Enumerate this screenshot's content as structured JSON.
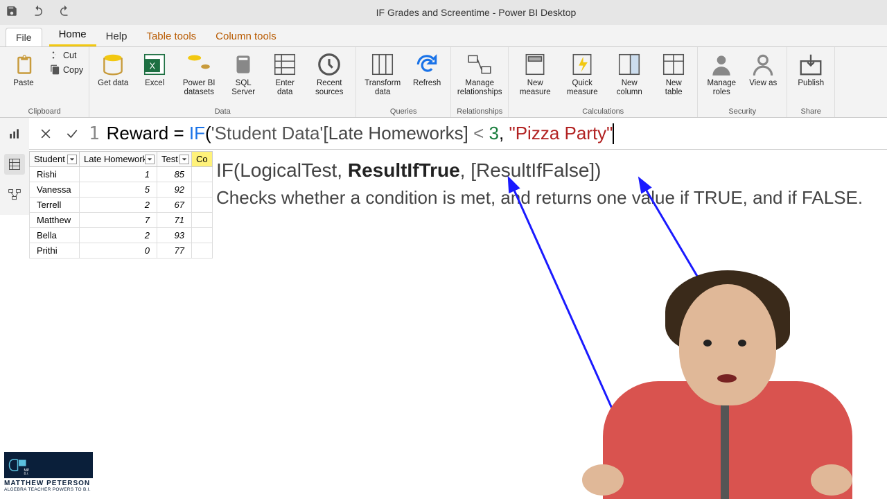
{
  "title": "IF Grades and Screentime - Power BI Desktop",
  "menu": {
    "file": "File",
    "tabs": [
      "Home",
      "Help",
      "Table tools",
      "Column tools"
    ],
    "active_index": 0
  },
  "ribbon": {
    "clipboard": {
      "label": "Clipboard",
      "paste": "Paste",
      "cut": "Cut",
      "copy": "Copy"
    },
    "data": {
      "label": "Data",
      "get_data": "Get data",
      "excel": "Excel",
      "pbi_ds": "Power BI datasets",
      "sql": "SQL Server",
      "enter": "Enter data",
      "recent": "Recent sources"
    },
    "queries": {
      "label": "Queries",
      "transform": "Transform data",
      "refresh": "Refresh"
    },
    "relationships": {
      "label": "Relationships",
      "manage": "Manage relationships"
    },
    "calculations": {
      "label": "Calculations",
      "new_measure": "New measure",
      "quick_measure": "Quick measure",
      "new_column": "New column",
      "new_table": "New table"
    },
    "security": {
      "label": "Security",
      "manage_roles": "Manage roles",
      "view_as": "View as"
    },
    "share": {
      "label": "Share",
      "publish": "Publish"
    }
  },
  "formula": {
    "line": "1",
    "name": "Reward",
    "eq": " = ",
    "fn": "IF",
    "open": "(",
    "table": "'Student Data'",
    "col": "[Late Homeworks]",
    "op": " < ",
    "num": "3",
    "comma": ", ",
    "str": "\"Pizza Party\""
  },
  "table": {
    "headers": [
      "Student",
      "Late Homeworks",
      "Test",
      "Co"
    ],
    "rows": [
      {
        "student": "Rishi",
        "late": "1",
        "test": "85"
      },
      {
        "student": "Vanessa",
        "late": "5",
        "test": "92"
      },
      {
        "student": "Terrell",
        "late": "2",
        "test": "67"
      },
      {
        "student": "Matthew",
        "late": "7",
        "test": "71"
      },
      {
        "student": "Bella",
        "late": "2",
        "test": "93"
      },
      {
        "student": "Prithi",
        "late": "0",
        "test": "77"
      }
    ]
  },
  "tooltip": {
    "sig_pre": "IF(LogicalTest, ",
    "sig_bold": "ResultIfTrue",
    "sig_post": ", [ResultIfFalse])",
    "desc": "Checks whether a condition is met, and returns one value if TRUE, and if FALSE."
  },
  "logo": {
    "name": "MATTHEW PETERSON",
    "tagline": "ALGEBRA TEACHER POWERS TO B.I."
  }
}
